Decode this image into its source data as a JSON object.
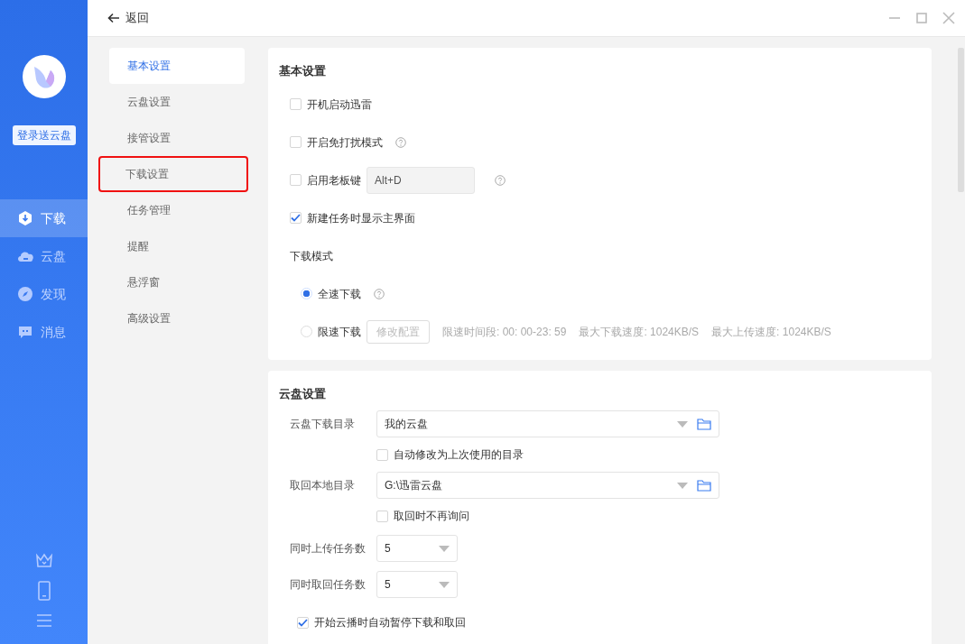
{
  "sidebar": {
    "login_button": "登录送云盘",
    "items": [
      {
        "label": "下载",
        "selected": true
      },
      {
        "label": "云盘",
        "selected": false
      },
      {
        "label": "发现",
        "selected": false
      },
      {
        "label": "消息",
        "selected": false
      }
    ]
  },
  "top_bar": {
    "back": "返回"
  },
  "settings_nav": [
    {
      "label": "基本设置",
      "selected": true,
      "highlighted": false
    },
    {
      "label": "云盘设置",
      "selected": false,
      "highlighted": false
    },
    {
      "label": "接管设置",
      "selected": false,
      "highlighted": false
    },
    {
      "label": "下载设置",
      "selected": false,
      "highlighted": true
    },
    {
      "label": "任务管理",
      "selected": false,
      "highlighted": false
    },
    {
      "label": "提醒",
      "selected": false,
      "highlighted": false
    },
    {
      "label": "悬浮窗",
      "selected": false,
      "highlighted": false
    },
    {
      "label": "高级设置",
      "selected": false,
      "highlighted": false
    }
  ],
  "basic_settings": {
    "title": "基本设置",
    "options": [
      {
        "kind": "checkbox",
        "label": "开机启动迅雷",
        "checked": false,
        "help": false
      },
      {
        "kind": "checkbox",
        "label": "开启免打扰模式",
        "checked": false,
        "help": true
      },
      {
        "kind": "hotkey",
        "label": "启用老板键",
        "checked": false,
        "value": "Alt+D",
        "disabled": true,
        "help": true
      },
      {
        "kind": "checkbox",
        "label": "新建任务时显示主界面",
        "checked": true,
        "help": false
      }
    ],
    "download_mode": {
      "title": "下载模式",
      "options": [
        {
          "label": "全速下载",
          "selected": true,
          "help": true
        },
        {
          "label": "限速下载",
          "selected": false,
          "help": false
        }
      ],
      "config_button": {
        "label": "修改配置",
        "disabled": true
      },
      "limit_info": [
        "限速时间段:  00: 00-23: 59",
        "最大下载速度: 1024KB/S",
        "最大上传速度: 1024KB/S"
      ]
    }
  },
  "cloud_settings": {
    "title": "云盘设置",
    "rows": [
      {
        "kind": "directory",
        "label": "云盘下载目录",
        "value": "我的云盘"
      },
      {
        "kind": "sub_checkbox",
        "label": "自动修改为上次使用的目录",
        "checked": false
      },
      {
        "kind": "directory",
        "label": "取回本地目录",
        "value": "G:\\迅雷云盘"
      },
      {
        "kind": "sub_checkbox",
        "label": "取回时不再询问",
        "checked": false
      },
      {
        "kind": "select",
        "label": "同时上传任务数",
        "value": "5"
      },
      {
        "kind": "select",
        "label": "同时取回任务数",
        "value": "5"
      },
      {
        "kind": "checkbox",
        "label": "开始云播时自动暂停下载和取回",
        "checked": true
      }
    ]
  }
}
